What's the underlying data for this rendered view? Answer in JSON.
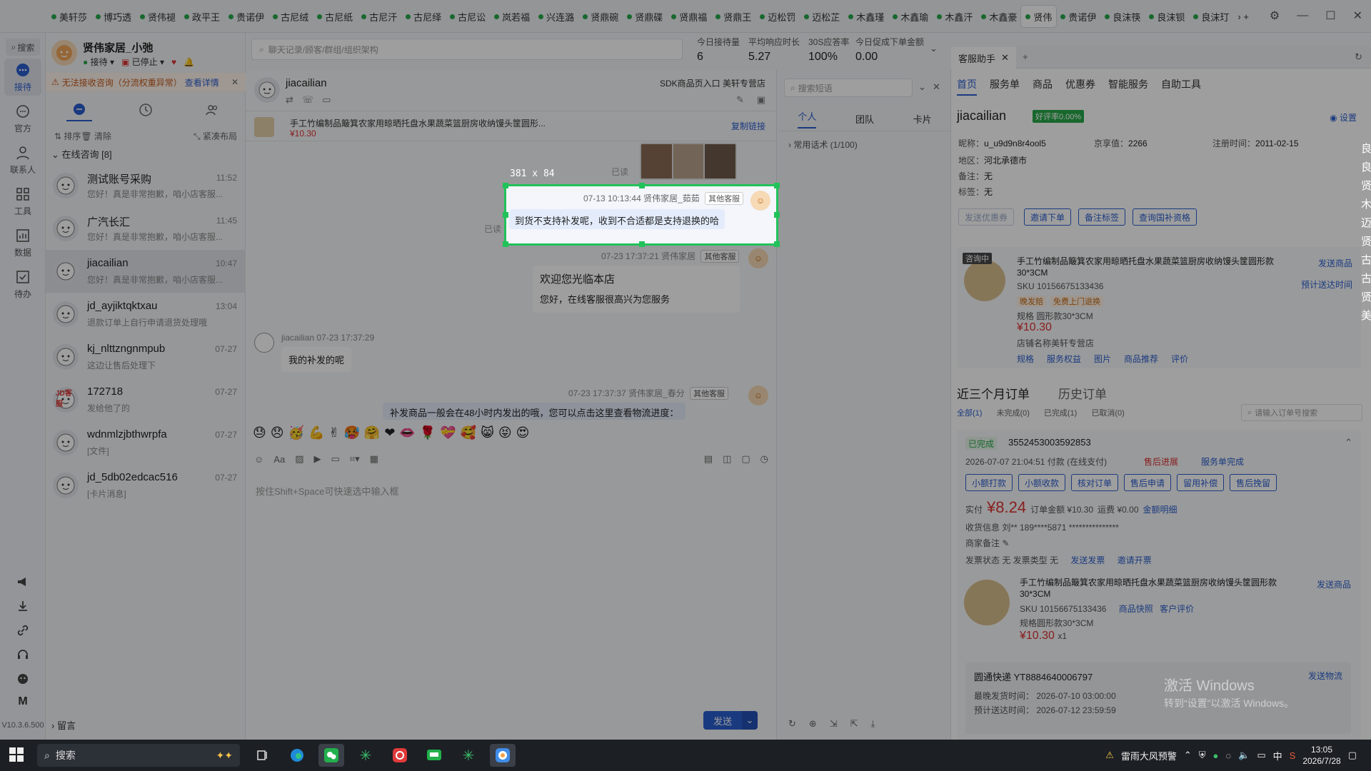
{
  "tabbar": {
    "tabs": [
      "美轩莎",
      "博巧透",
      "贤伟褪",
      "政平王",
      "贵诺伊",
      "古尼绒",
      "古尼纸",
      "古尼汗",
      "古尼绎",
      "古尼讼",
      "岚若福",
      "兴连潞",
      "贤鼎碗",
      "贤鼎碟",
      "贤鼎福",
      "贤鼎王",
      "迈松罚",
      "迈松芷",
      "木鑫瑾",
      "木鑫瑜",
      "木鑫汗",
      "木鑫豪",
      "贤伟",
      "贵诺伊",
      "良沫筷",
      "良沫钡",
      "良沫玎"
    ],
    "active_index": 22
  },
  "rail": {
    "search": "搜索",
    "items": [
      "接待",
      "官方",
      "联系人",
      "工具",
      "数据",
      "待办"
    ],
    "version": "V10.3.6.500"
  },
  "agent": {
    "name": "贤伟家居_小弛",
    "status_receive": "接待",
    "status_stopped": "已停止"
  },
  "warning": {
    "text": "无法接收咨询（分流权重异常）",
    "link": "查看详情"
  },
  "conv_tools": {
    "sort": "排序",
    "clear": "清除",
    "layout": "紧凑布局"
  },
  "section": {
    "title": "在线咨询 [8]",
    "leave_msg": "留言"
  },
  "conversations": [
    {
      "name": "测试账号采购",
      "preview": "您好！真是非常抱歉，咱小店客服...",
      "time": "11:52"
    },
    {
      "name": "广汽长汇",
      "preview": "您好！真是非常抱歉，咱小店客服...",
      "time": "11:45"
    },
    {
      "name": "jiacailian",
      "preview": "您好！真是非常抱歉，咱小店客服...",
      "time": "10:47"
    },
    {
      "name": "jd_ayjiktqktxau",
      "preview": "退款订单上自行申请退货处理哦",
      "time": "13:04"
    },
    {
      "name": "kj_nlttzngnmpub",
      "preview": "这边让售后处理下",
      "time": "07-27"
    },
    {
      "name": "172718",
      "preview": "发给他了的",
      "time": "07-27",
      "badge": "JD客服"
    },
    {
      "name": "wdnmlzjbthwrpfa",
      "preview": "[文件]",
      "time": "07-27"
    },
    {
      "name": "jd_5db02edcac516",
      "preview": "[卡片消息]",
      "time": "07-27"
    }
  ],
  "topsearch": {
    "placeholder": "聊天记录/顾客/群组/组织架构"
  },
  "stats": [
    {
      "label": "今日接待量",
      "value": "6"
    },
    {
      "label": "平均响应时长",
      "value": "5.27"
    },
    {
      "label": "30S应答率",
      "value": "100%"
    },
    {
      "label": "今日促成下单金额",
      "value": "0.00"
    }
  ],
  "chat": {
    "customer": "jiacailian",
    "source": "SDK商品页入口  美轩专营店",
    "product_title": "手工竹编制品簸箕农家用晾晒托盘水果蔬菜篮厨房收纳馒头筐圆形...",
    "product_price": "¥10.30",
    "copy_link": "复制链接",
    "msg1": {
      "time": "07-13 10:13:44",
      "sender": "贤伟家居_茹茹",
      "tag": "其他客服",
      "text": "到货不支持补发呢，收到不合适都是支持退换的哈"
    },
    "read1": "已读",
    "read2": "已读",
    "msg2": {
      "time": "07-23 17:37:21",
      "sender": "贤伟家居",
      "tag": "其他客服",
      "title": "欢迎您光临本店",
      "text": "您好，在线客服很高兴为您服务"
    },
    "msg3": {
      "sender": "jiacailian",
      "time": "07-23 17:37:29",
      "text": "我的补发的呢"
    },
    "msg4": {
      "time": "07-23 17:37:37",
      "sender": "贤伟家居_春分",
      "tag": "其他客服",
      "text": "补发商品一般会在48小时内发出的哦，您可以点击这里查看物流进度："
    },
    "emojis": [
      "😓",
      "😞",
      "🥳",
      "💪",
      "✌",
      "🥵",
      "🤗",
      "❤",
      "👄",
      "🌹",
      "💝",
      "🥰",
      "😸",
      "😝",
      "😍"
    ],
    "input_hint": "按住Shift+Space可快速选中输入框",
    "send": "发送"
  },
  "phrase": {
    "search_placeholder": "搜索短语",
    "tabs": [
      "个人",
      "团队",
      "卡片"
    ],
    "group": "常用话术 (1/100)"
  },
  "assistant": {
    "tab": "客服助手",
    "nav": [
      "首页",
      "服务单",
      "商品",
      "优惠券",
      "智能服务",
      "自助工具"
    ],
    "customer": "jiacailian",
    "score": "好评率0.00%",
    "settings": "设置",
    "nickname_label": "昵称：",
    "nickname": "u_u9d9n8r4ool5",
    "jx_label": "京享值：",
    "jx": "2266",
    "reg_label": "注册时间：",
    "reg": "2011-02-15",
    "region_label": "地区：",
    "region": "河北承德市",
    "remark_label": "备注：",
    "remark": "无",
    "tag_label": "标签：",
    "tag": "无",
    "buttons": [
      "发送优惠券",
      "邀请下单",
      "备注标签",
      "查询国补资格"
    ],
    "consult_badge": "咨询中",
    "product": {
      "title": "手工竹编制品簸箕农家用晾晒托盘水果蔬菜篮厨房收纳馒头筐圆形款30*3CM",
      "sku": "SKU 10156675133436",
      "tags": [
        "晚发赔",
        "免费上门退换"
      ],
      "spec": "规格 圆形款30*3CM",
      "price": "¥10.30",
      "shop": "店铺名称美轩专营店",
      "links": [
        "规格",
        "服务权益",
        "图片",
        "商品推荐",
        "评价"
      ],
      "send": "发送商品",
      "estimate": "预计送达时间"
    },
    "orders_head": [
      "近三个月订单",
      "历史订单"
    ],
    "order_filters": [
      "全部(1)",
      "未完成(0)",
      "已完成(1)",
      "已取消(0)"
    ],
    "order_search": "请输入订单号搜索",
    "order": {
      "status": "已完成",
      "no": "3552453003592853",
      "time": "2026-07-07 21:04:51 付款 (在线支付)",
      "aftersale": "售后进展",
      "aftersale_done": "服务单完成",
      "buttons": [
        "小额打款",
        "小额收款",
        "核对订单",
        "售后申请",
        "留用补偿",
        "售后挽留"
      ],
      "paid_label": "实付",
      "paid": "¥8.24",
      "amount": "订单金额 ¥10.30",
      "freight": "运费 ¥0.00",
      "detail": "金额明细",
      "recv": "收货信息 刘**    189****5871    ***************",
      "memo": "商家备注",
      "invoice": "发票状态 无   发票类型 无",
      "send_invoice": "发送发票",
      "invite_invoice": "邀请开票",
      "item_title": "手工竹编制品簸箕农家用晾晒托盘水果蔬菜篮厨房收纳馒头筐圆形款30*3CM",
      "item_sku": "SKU 10156675133436",
      "snapshot": "商品快照",
      "review": "客户评价",
      "item_spec": "规格圆形款30*3CM",
      "item_price": "¥10.30",
      "item_qty": "x1",
      "item_send": "发送商品",
      "express": "圆通快递 YT8884640006797",
      "latest_ship": "最晚发货时间：    2026-07-10 03:00:00",
      "estimate": "预计送达时间：    2026-07-12 23:59:59",
      "send_express": "发送物流"
    }
  },
  "overlay": {
    "size": "381 x 84"
  },
  "watermark": {
    "title": "激活 Windows",
    "sub": "转到“设置”以激活 Windows。"
  },
  "right_edge_chars": "良良贤木迈贤古古贤美",
  "taskbar": {
    "search": "搜索",
    "weather": "雷雨大风预警",
    "time": "13:05",
    "date": "2026/7/28",
    "ime": "中"
  }
}
